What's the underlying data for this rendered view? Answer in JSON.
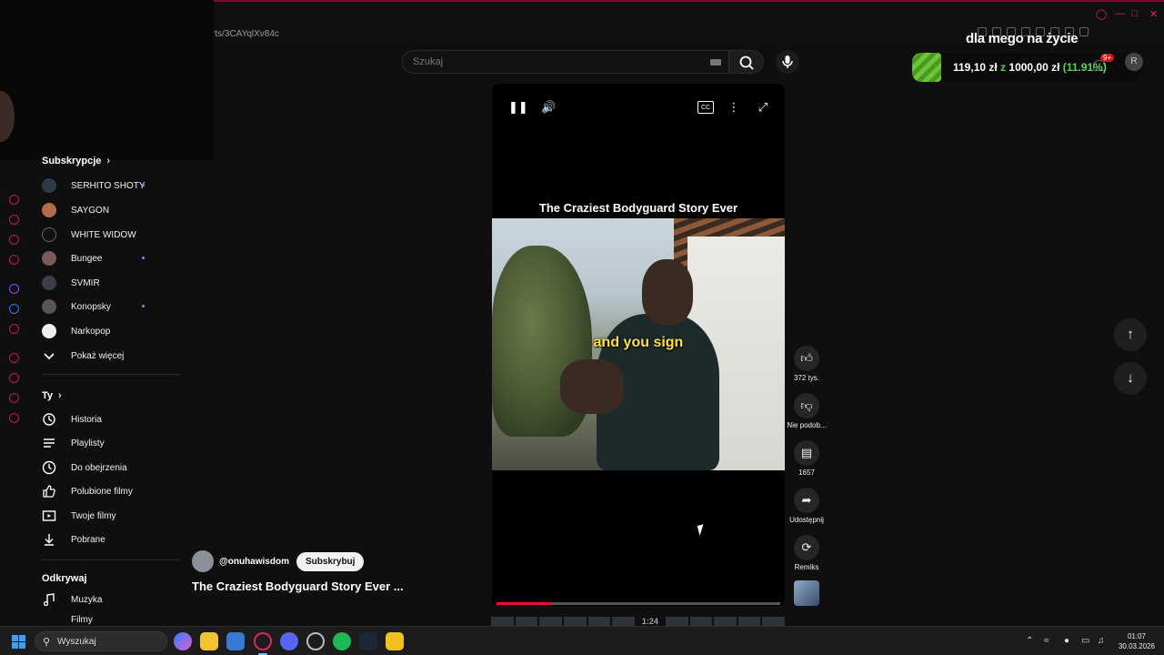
{
  "browser": {
    "url": "rts/3CAYqlXv84c"
  },
  "overlay": {
    "title": "dla mego na życie",
    "bet_amount": "119,10 zł",
    "bet_sep": "z",
    "bet_total": "1000,00 zł",
    "bet_percent": "(11.91%)",
    "notification_count": "9+",
    "avatar_letter": "R"
  },
  "search": {
    "placeholder": "Szukaj"
  },
  "sidebar": {
    "subscriptions_header": "Subskrypcje",
    "subscriptions": [
      {
        "label": "SERHITO SHOTY",
        "new": true
      },
      {
        "label": "SAYGON",
        "new": false
      },
      {
        "label": "WHITE WIDOW",
        "new": false
      },
      {
        "label": "Bungee",
        "new": true
      },
      {
        "label": "SVMIR",
        "new": false
      },
      {
        "label": "Konopsky",
        "new": true
      },
      {
        "label": "Narkopop",
        "new": false
      }
    ],
    "show_more": "Pokaż więcej",
    "you_header": "Ty",
    "you_items": [
      {
        "label": "Historia",
        "icon": "history-icon"
      },
      {
        "label": "Playlisty",
        "icon": "playlist-icon"
      },
      {
        "label": "Do obejrzenia",
        "icon": "clock-icon"
      },
      {
        "label": "Polubione filmy",
        "icon": "thumb-up-icon"
      },
      {
        "label": "Twoje filmy",
        "icon": "video-icon"
      },
      {
        "label": "Pobrane",
        "icon": "download-icon"
      }
    ],
    "explore_header": "Odkrywaj",
    "explore_items": [
      {
        "label": "Muzyka",
        "icon": "music-icon"
      },
      {
        "label": "Filmy",
        "icon": "film-icon"
      }
    ]
  },
  "player": {
    "overlay_title": "The Craziest Bodyguard Story Ever",
    "caption": "and you sign",
    "progress": 0.19
  },
  "actions": {
    "likes": "372 tys.",
    "dislike": "Nie podob...",
    "comments": "1657",
    "share": "Udostępnij",
    "remix": "Remiks"
  },
  "video": {
    "channel": "@onuhawisdom",
    "subscribe": "Subskrybuj",
    "title": "The Craziest Bodyguard Story Ever ..."
  },
  "strip": {
    "time": "1:24"
  },
  "taskbar": {
    "search_placeholder": "Wyszukaj",
    "time": "01:07",
    "date": "30.03.2026"
  }
}
